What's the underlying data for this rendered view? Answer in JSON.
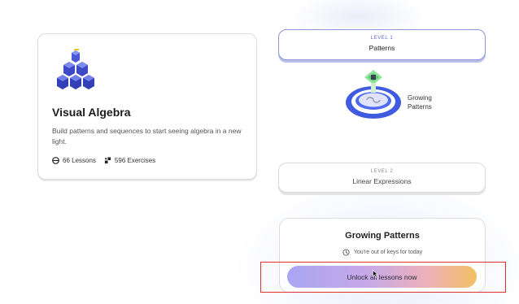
{
  "course": {
    "title": "Visual Algebra",
    "description": "Build patterns and sequences to start seeing algebra in a new light.",
    "lessons": "66 Lessons",
    "exercises": "596 Exercises",
    "icon": "stacked-cubes-icon"
  },
  "levels": [
    {
      "label": "LEVEL 1",
      "name": "Patterns",
      "state": "active"
    },
    {
      "label": "LEVEL 2",
      "name": "Linear Expressions",
      "state": "locked"
    }
  ],
  "node": {
    "label_line1": "Growing",
    "label_line2": "Patterns",
    "icon": "lesson-node-icon"
  },
  "lesson_card": {
    "title": "Growing Patterns",
    "keys_status": "You're out of keys for today",
    "unlock_label": "Unlock all lessons now"
  },
  "colors": {
    "accent": "#8c96d8",
    "highlight": "#e03131",
    "button_gradient": [
      "#a8a6f2",
      "#eeb2b6",
      "#f0c063"
    ]
  }
}
